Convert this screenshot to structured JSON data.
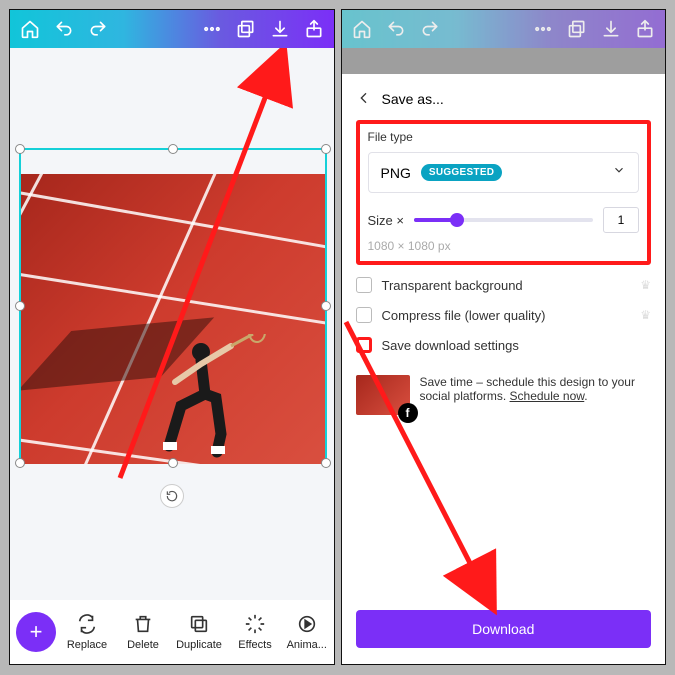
{
  "left": {
    "tools": {
      "replace": "Replace",
      "delete": "Delete",
      "duplicate": "Duplicate",
      "effects": "Effects",
      "animate": "Anima..."
    }
  },
  "right": {
    "sheet_title": "Save as...",
    "file_type_label": "File type",
    "file_type_value": "PNG",
    "file_type_badge": "SUGGESTED",
    "size_label": "Size ×",
    "size_value": "1",
    "dimensions": "1080 × 1080 px",
    "checks": {
      "transparent": "Transparent background",
      "compress": "Compress file (lower quality)",
      "save_settings": "Save download settings"
    },
    "promo_text_1": "Save time – schedule this design to your social platforms. ",
    "promo_link": "Schedule now",
    "download_label": "Download"
  }
}
